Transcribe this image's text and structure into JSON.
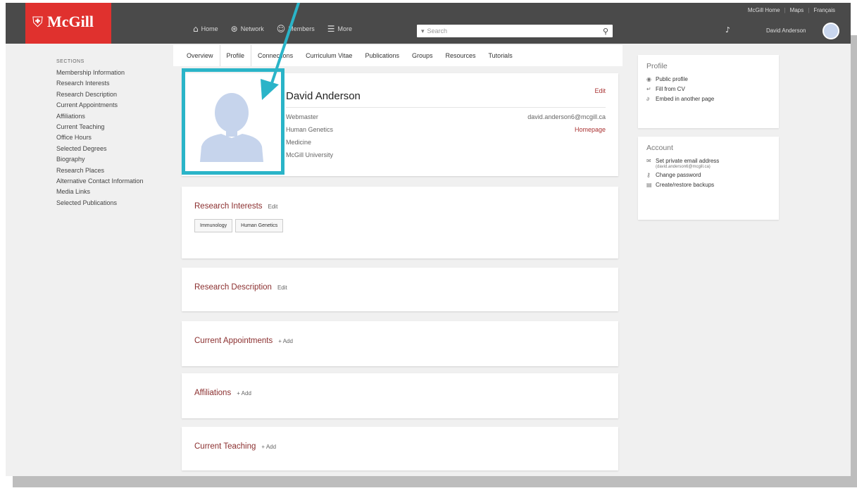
{
  "topbar": {
    "brand": "McGill",
    "utility_links": [
      "McGill Home",
      "Maps",
      "Français"
    ],
    "nav": [
      {
        "icon": "home-icon",
        "label": "Home"
      },
      {
        "icon": "network-icon",
        "label": "Network"
      },
      {
        "icon": "members-icon",
        "label": "Members"
      },
      {
        "icon": "menu-icon",
        "label": "More"
      }
    ],
    "search_placeholder": "Search",
    "user_name": "David Anderson"
  },
  "sidebar": {
    "heading": "SECTIONS",
    "items": [
      "Membership Information",
      "Research Interests",
      "Research Description",
      "Current Appointments",
      "Affiliations",
      "Current Teaching",
      "Office Hours",
      "Selected Degrees",
      "Biography",
      "Research Places",
      "Alternative Contact Information",
      "Media Links",
      "Selected Publications"
    ]
  },
  "tabs": [
    "Overview",
    "Profile",
    "Connections",
    "Curriculum Vitae",
    "Publications",
    "Groups",
    "Resources",
    "Tutorials"
  ],
  "active_tab": "Profile",
  "profile": {
    "name": "David Anderson",
    "edit_label": "Edit",
    "title": "Webmaster",
    "department": "Human Genetics",
    "faculty": "Medicine",
    "institution": "McGill University",
    "email": "david.anderson6@mcgill.ca",
    "homepage_label": "Homepage"
  },
  "sections": [
    {
      "title": "Research Interests",
      "action": "Edit",
      "tags": [
        "Immunology",
        "Human Genetics"
      ]
    },
    {
      "title": "Research Description",
      "action": "Edit"
    },
    {
      "title": "Current Appointments",
      "action": "+ Add"
    },
    {
      "title": "Affiliations",
      "action": "+ Add"
    },
    {
      "title": "Current Teaching",
      "action": "+ Add"
    }
  ],
  "right_panel_profile": {
    "title": "Profile",
    "links": [
      "Public profile",
      "Fill from CV",
      "Embed in another page"
    ]
  },
  "right_panel_account": {
    "title": "Account",
    "links": [
      "Set private email address",
      "Change password",
      "Create/restore backups"
    ],
    "private_email": "(david.anderson6@mcgill.ca)"
  },
  "colors": {
    "brand_red": "#e0312e",
    "topbar": "#4a4a4a",
    "section_title": "#8b2f2f",
    "highlight": "#2ab4c8"
  }
}
